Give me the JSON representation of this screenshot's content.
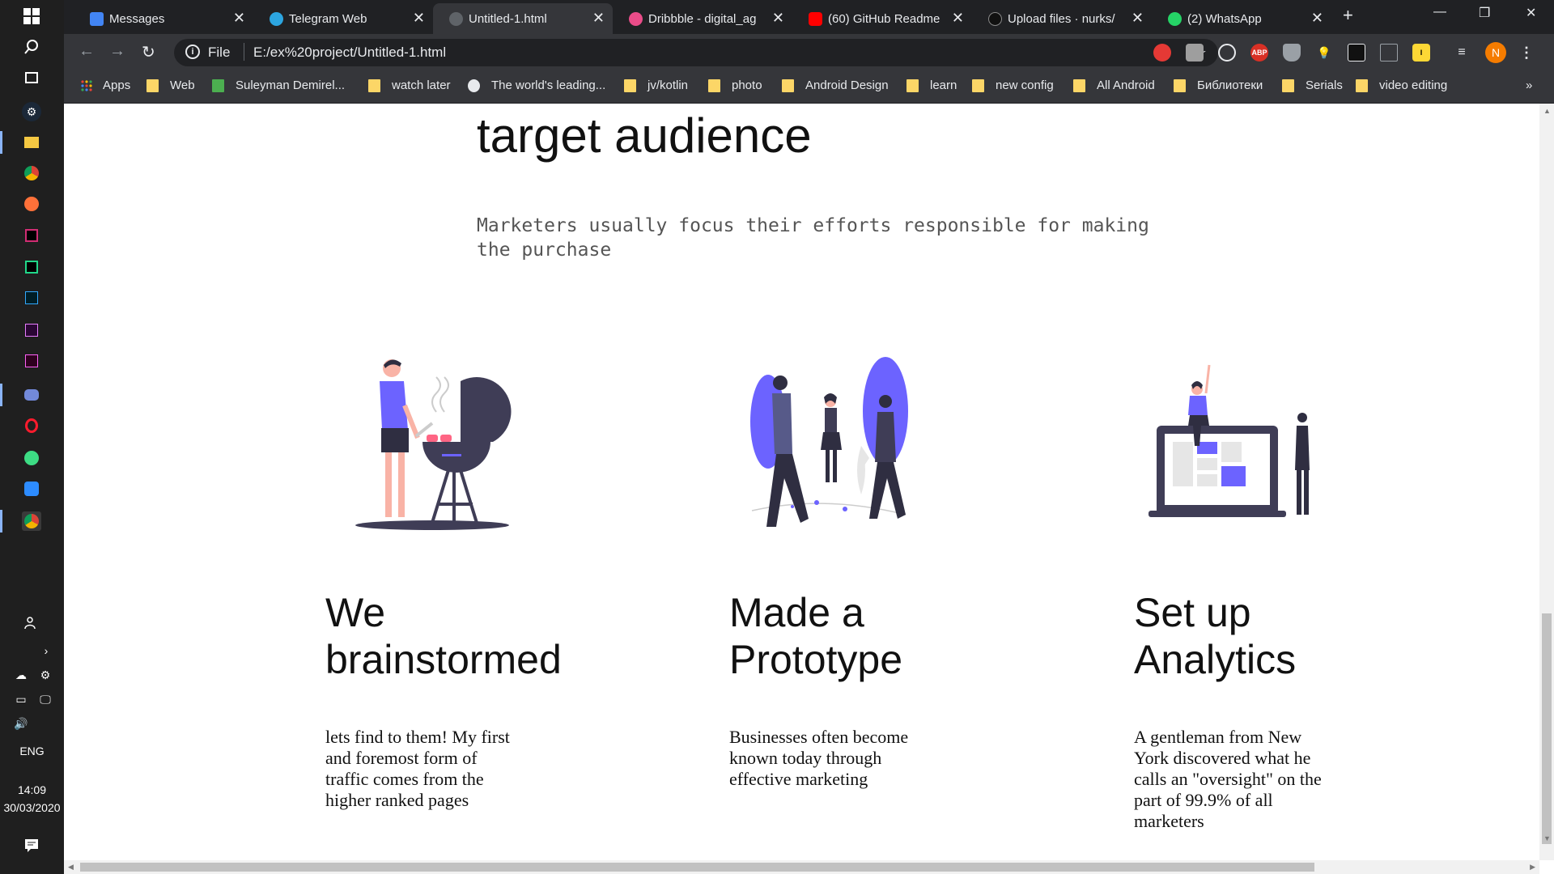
{
  "taskbar": {
    "language": "ENG",
    "time": "14:09",
    "date": "30/03/2020"
  },
  "tabs": [
    {
      "label": "Messages",
      "active": false
    },
    {
      "label": "Telegram Web",
      "active": false
    },
    {
      "label": "Untitled-1.html",
      "active": true
    },
    {
      "label": "Dribbble - digital_ag",
      "active": false
    },
    {
      "label": "(60) GitHub Readme",
      "active": false
    },
    {
      "label": "Upload files · nurks/",
      "active": false
    },
    {
      "label": "(2) WhatsApp",
      "active": false
    }
  ],
  "omnibox": {
    "scheme": "File",
    "url": "E:/ex%20project/Untitled-1.html"
  },
  "profile_initial": "N",
  "bookmarks": [
    "Apps",
    "Web",
    "Suleyman Demirel...",
    "watch later",
    "The world's leading...",
    "jv/kotlin",
    "photo",
    "Android Design",
    "learn",
    "new config",
    "All Android",
    "Библиотеки",
    "Serials",
    "video editing"
  ],
  "page": {
    "heading": "target audience",
    "subtitle": "Marketers usually focus their efforts responsible for making the purchase",
    "features": [
      {
        "title_line1": "We",
        "title_line2": "brainstormed",
        "text": "lets find to them! My first and foremost form of traffic comes from the higher ranked pages"
      },
      {
        "title_line1": "Made a",
        "title_line2": "Prototype",
        "text": "Businesses often become known today through effective marketing"
      },
      {
        "title_line1": "Set up",
        "title_line2": "Analytics",
        "text": "A gentleman from New York discovered what he calls an \"oversight\" on the part of 99.9% of all marketers"
      }
    ]
  },
  "colors": {
    "accent": "#6c63ff",
    "dark": "#3f3d56",
    "chrome_bg": "#202124",
    "chrome_toolbar": "#35363a"
  }
}
